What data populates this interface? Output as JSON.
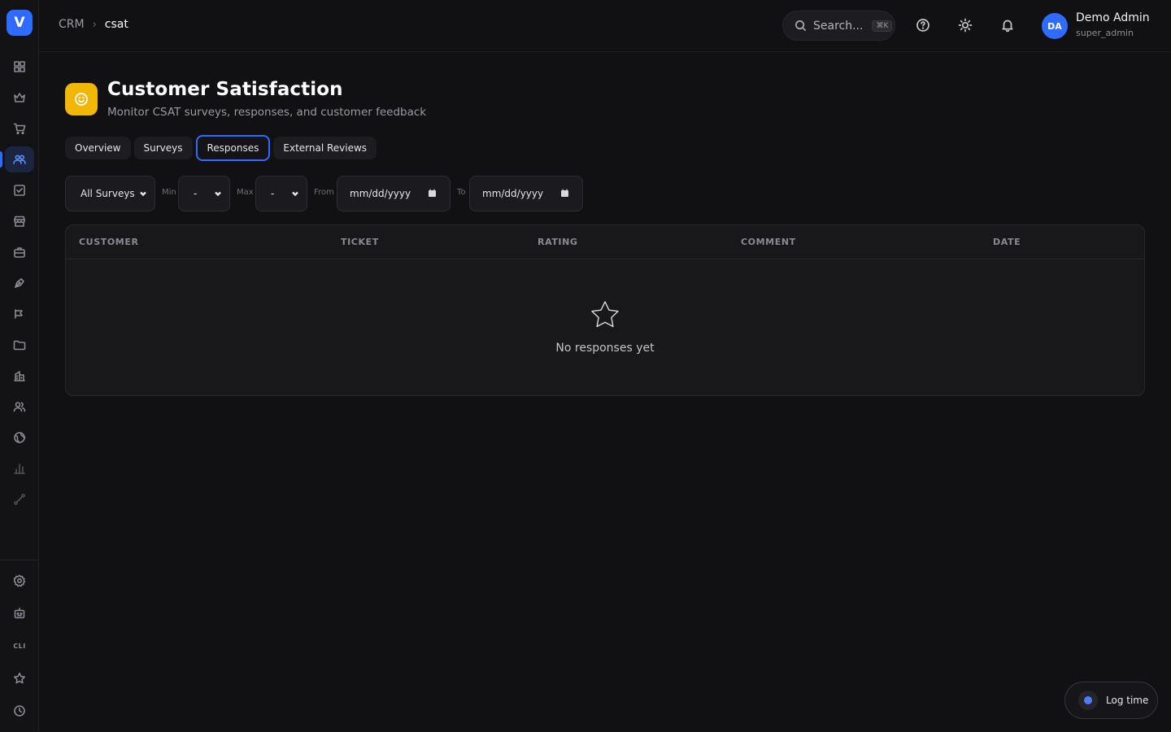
{
  "app": {
    "logo_letter": "V"
  },
  "breadcrumb": {
    "root": "CRM",
    "separator": "›",
    "current": "csat"
  },
  "search": {
    "placeholder": "Search...",
    "shortcut": "⌘K"
  },
  "user": {
    "initials": "DA",
    "name": "Demo Admin",
    "role": "super_admin"
  },
  "page": {
    "title": "Customer Satisfaction",
    "subtitle": "Monitor CSAT surveys, responses, and customer feedback",
    "icon": "smile-icon"
  },
  "tabs": [
    {
      "label": "Overview",
      "active": false
    },
    {
      "label": "Surveys",
      "active": false
    },
    {
      "label": "Responses",
      "active": true
    },
    {
      "label": "External Reviews",
      "active": false
    }
  ],
  "filters": {
    "survey": "All Surveys",
    "min_label": "Min",
    "min_value": "-",
    "max_label": "Max",
    "max_value": "-",
    "from_label": "From",
    "from_value": "mm/dd/yyyy",
    "to_label": "To",
    "to_value": "mm/dd/yyyy"
  },
  "table": {
    "columns": [
      "CUSTOMER",
      "TICKET",
      "RATING",
      "COMMENT",
      "DATE"
    ],
    "empty_message": "No responses yet"
  },
  "sidebar": {
    "icons": [
      "grid-icon",
      "crown-icon",
      "cart-icon",
      "users-icon",
      "check-square-icon",
      "store-icon",
      "briefcase-icon",
      "pen-icon",
      "megaphone-icon",
      "folder-icon",
      "building-icon",
      "team-icon",
      "globe-icon",
      "bar-chart-icon",
      "route-icon",
      "settings-icon",
      "bot-icon",
      "cli",
      "star-icon",
      "clock-icon"
    ],
    "cli_label": "CLI",
    "active_item": "users-icon"
  },
  "log_time": {
    "label": "Log time"
  },
  "colors": {
    "accent": "#2f6bff",
    "page_icon": "#f2b705",
    "background": "#111114"
  }
}
